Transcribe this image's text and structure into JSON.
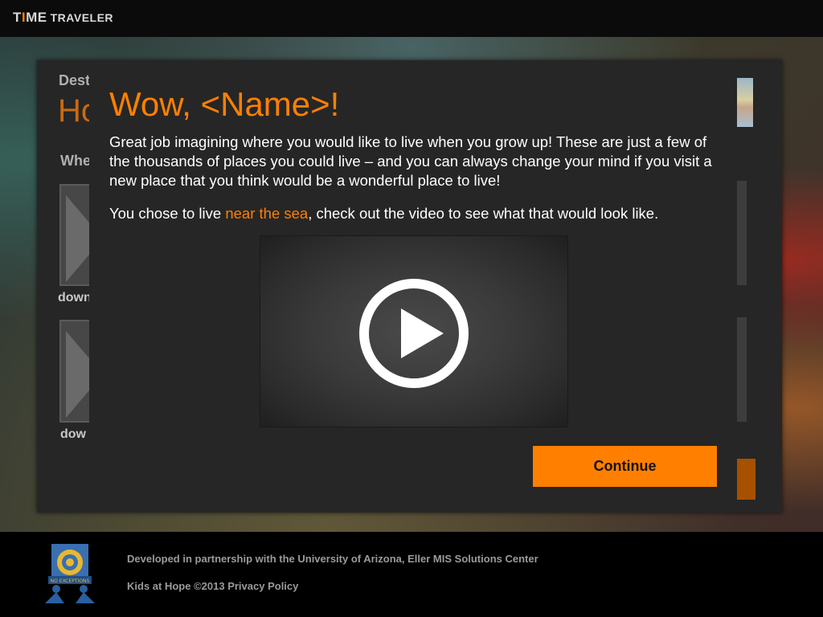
{
  "header": {
    "logo_part1_prefix": "T",
    "logo_part1_accent": "I",
    "logo_part1_suffix": "ME",
    "logo_part2": "TRAVELER"
  },
  "background_page": {
    "destination_label": "Dest",
    "title_fragment": "Ho",
    "question_fragment": "Whe",
    "thumb_captions": [
      "down",
      "dow"
    ]
  },
  "modal": {
    "title": "Wow, <Name>!",
    "body": "Great job imagining where you would like to live when you grow up!  These are just a few of the thousands of places you could live – and you can always change your mind if you visit a new place that you think would be a wonderful place to live!",
    "choice_prefix": "You chose to live ",
    "choice_value": "near the sea",
    "choice_suffix": ", check out the video to see what that would look like.",
    "video_icon": "play-icon",
    "continue_label": "Continue"
  },
  "footer": {
    "logo_text": "NO EXCEPTIONS",
    "partnership_text": "Developed in partnership with the University of Arizona, Eller MIS Solutions Center",
    "copyright_text": "Kids at Hope ©2013",
    "privacy_label": "Privacy Policy"
  },
  "colors": {
    "accent": "#ff8000",
    "panel": "#262626",
    "background": "#000000"
  }
}
